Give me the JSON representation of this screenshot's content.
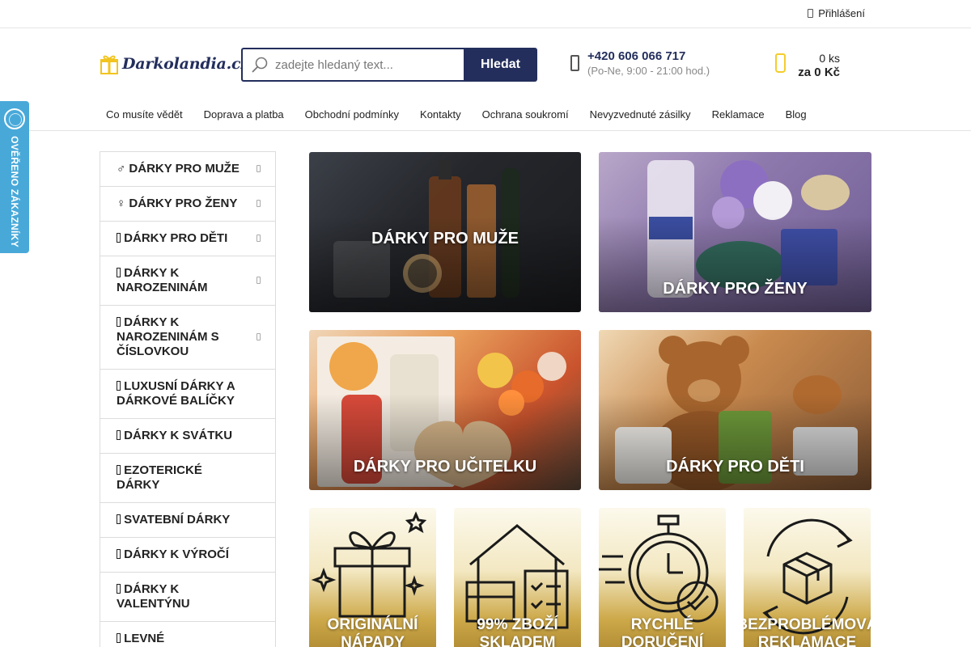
{
  "topbar": {
    "login_label": "Přihlášení"
  },
  "logo": {
    "text": "Darkolandia.cz"
  },
  "search": {
    "placeholder": "zadejte hledaný text...",
    "button_label": "Hledat"
  },
  "contact": {
    "phone": "+420 606 066 717",
    "hours": "(Po-Ne, 9:00 - 21:00 hod.)"
  },
  "cart": {
    "count": "0 ks",
    "total": "za 0 Kč"
  },
  "nav": {
    "items": [
      "Co musíte vědět",
      "Doprava a platba",
      "Obchodní podmínky",
      "Kontakty",
      "Ochrana soukromí",
      "Nevyzvednuté zásilky",
      "Reklamace",
      "Blog"
    ]
  },
  "badge": {
    "text": "OVĚŘENO ZÁKAZNÍKY"
  },
  "sidebar": {
    "items": [
      {
        "glyph": "♂",
        "label": "DÁRKY PRO MUŽE",
        "has_submenu": true
      },
      {
        "glyph": "♀",
        "label": "DÁRKY PRO ŽENY",
        "has_submenu": true
      },
      {
        "glyph": "",
        "label": "DÁRKY PRO DĚTI",
        "has_submenu": true
      },
      {
        "glyph": "",
        "label": "DÁRKY K NAROZENINÁM",
        "has_submenu": true
      },
      {
        "glyph": "",
        "label": "DÁRKY K NAROZENINÁM S ČÍSLOVKOU",
        "has_submenu": true
      },
      {
        "glyph": "",
        "label": "LUXUSNÍ DÁRKY A DÁRKOVÉ BALÍČKY",
        "has_submenu": false
      },
      {
        "glyph": "",
        "label": "DÁRKY K SVÁTKU",
        "has_submenu": false
      },
      {
        "glyph": "",
        "label": "EZOTERICKÉ DÁRKY",
        "has_submenu": false
      },
      {
        "glyph": "",
        "label": "SVATEBNÍ DÁRKY",
        "has_submenu": false
      },
      {
        "glyph": "",
        "label": "DÁRKY K VÝROČÍ",
        "has_submenu": false
      },
      {
        "glyph": "",
        "label": "DÁRKY K VALENTÝNU",
        "has_submenu": false
      },
      {
        "glyph": "",
        "label": "LEVNÉ",
        "has_submenu": false
      }
    ]
  },
  "tiles": [
    {
      "label": "DÁRKY PRO MUŽE"
    },
    {
      "label": "DÁRKY PRO ŽENY"
    },
    {
      "label": "DÁRKY PRO UČITELKU"
    },
    {
      "label": "DÁRKY PRO DĚTI"
    }
  ],
  "features": [
    {
      "line1": "ORIGINÁLNÍ",
      "line2": "NÁPADY",
      "icon": "gift-icon"
    },
    {
      "line1": "99% ZBOŽÍ",
      "line2": "SKLADEM",
      "icon": "warehouse-icon"
    },
    {
      "line1": "RYCHLÉ",
      "line2": "DORUČENÍ",
      "icon": "stopwatch-icon"
    },
    {
      "line1": "BEZPROBLÉMOVÁ",
      "line2": "REKLAMACE",
      "icon": "return-box-icon"
    }
  ],
  "colors": {
    "navy": "#232e5c",
    "accent_yellow": "#f5cc2c",
    "badge_blue": "#48a9d9"
  }
}
